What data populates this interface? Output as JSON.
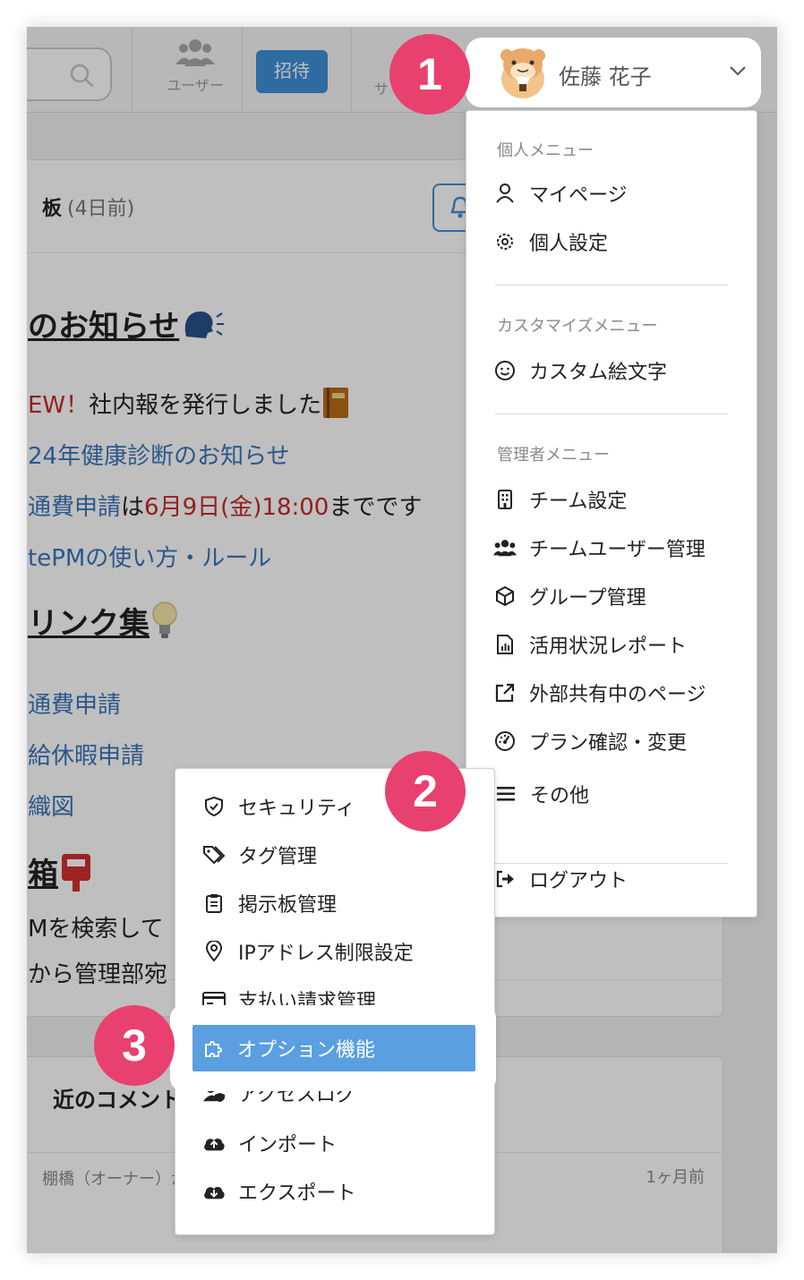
{
  "topbar": {
    "users_label": "ユーザー",
    "invite_label": "招待",
    "cut_label": "サ",
    "user_name": "佐藤 花子"
  },
  "board": {
    "title": "板",
    "age": "(4日前)",
    "notice_heading": "のお知らせ",
    "line1_prefix": "EW！",
    "line1_text": "社内報を発行しました",
    "line2": "24年健康診断のお知らせ",
    "line3_link": "通費申請",
    "line3_mid": "は",
    "line3_red": "6月9日(金)18:00",
    "line3_tail": "までです",
    "line4": "tePMの使い方・ルール",
    "links_heading": "リンク集",
    "link1": "通費申請",
    "link2": "給休暇申請",
    "link3": "織図",
    "box_heading": "箱",
    "box_line1": "Mを検索して",
    "box_line2": "から管理部宛"
  },
  "comments": {
    "title": "近のコメント",
    "owner": "棚橋（オーナー）が",
    "time": "1ヶ月前"
  },
  "user_menu": {
    "personal_section": "個人メニュー",
    "mypage": "マイページ",
    "personal_settings": "個人設定",
    "customize_section": "カスタマイズメニュー",
    "custom_emoji": "カスタム絵文字",
    "admin_section": "管理者メニュー",
    "team_settings": "チーム設定",
    "team_users": "チームユーザー管理",
    "group_mgmt": "グループ管理",
    "usage_report": "活用状況レポート",
    "external_pages": "外部共有中のページ",
    "plan": "プラン確認・変更",
    "other": "その他",
    "logout": "ログアウト"
  },
  "sub_menu": {
    "security": "セキュリティ",
    "tags": "タグ管理",
    "board_mgmt": "掲示板管理",
    "ip_limit": "IPアドレス制限設定",
    "billing": "支払い請求管理",
    "options": "オプション機能",
    "access_log": "アクセスログ",
    "import": "インポート",
    "export": "エクスポート"
  },
  "badges": {
    "b1": "1",
    "b2": "2",
    "b3": "3"
  },
  "colors": {
    "accent": "#3d8fd7",
    "badge": "#e8416f",
    "active": "#5a9fe0"
  }
}
